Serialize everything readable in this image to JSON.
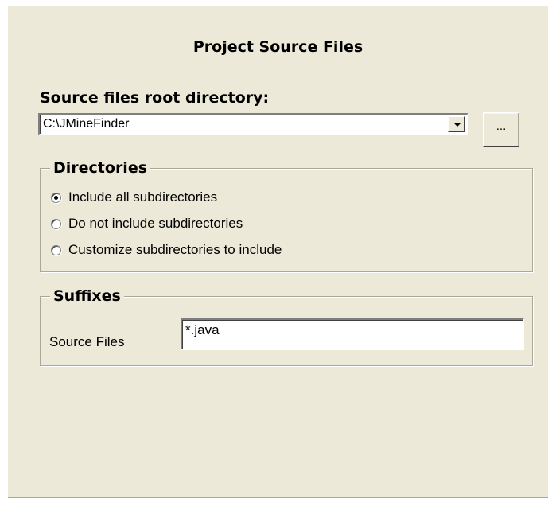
{
  "title": "Project Source Files",
  "root": {
    "label": "Source files root directory:",
    "value": "C:\\JMineFinder",
    "browse_label": "..."
  },
  "directories": {
    "legend": "Directories",
    "options": [
      {
        "label": "Include all subdirectories",
        "checked": true
      },
      {
        "label": "Do not include subdirectories",
        "checked": false
      },
      {
        "label": "Customize subdirectories to include",
        "checked": false
      }
    ]
  },
  "suffixes": {
    "legend": "Suffixes",
    "source_label": "Source Files",
    "source_value": "*.java"
  }
}
